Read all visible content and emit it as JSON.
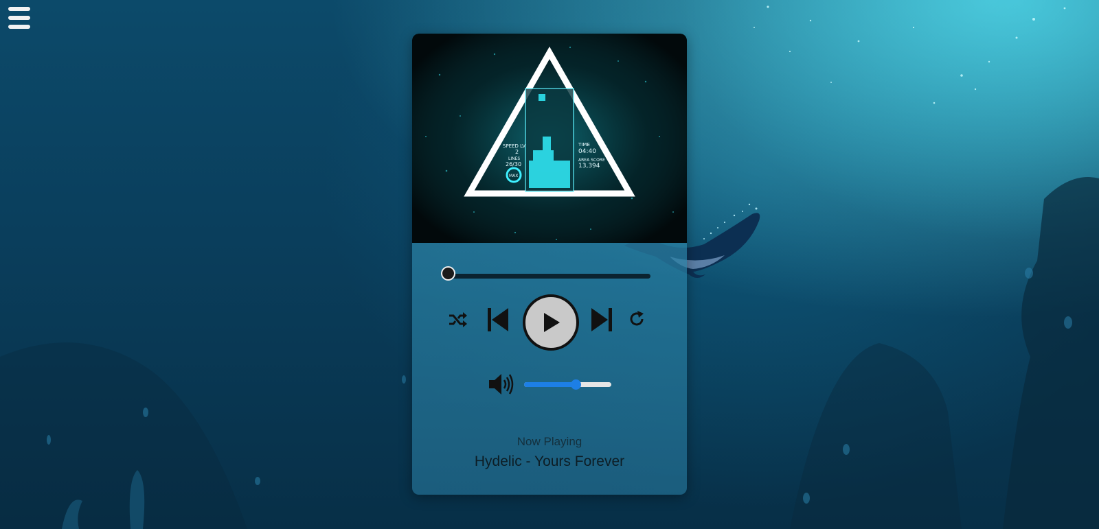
{
  "app": {
    "menu_icon": "hamburger-menu-icon"
  },
  "artwork": {
    "speed_label": "SPEED LV",
    "speed_value": "2",
    "lines_label": "LINES",
    "lines_value": "26/30",
    "max_label": "MAX",
    "time_label": "TIME",
    "time_value": "04:40",
    "score_label": "AREA SCORE",
    "score_value": "13,394"
  },
  "player": {
    "progress": 0.0,
    "controls": {
      "shuffle_icon": "shuffle-icon",
      "previous_icon": "skip-previous-icon",
      "play_icon": "play-icon",
      "next_icon": "skip-next-icon",
      "repeat_icon": "repeat-icon"
    },
    "volume": {
      "icon": "volume-icon",
      "level": 0.6
    },
    "now_playing_label": "Now Playing",
    "track_title": "Hydelic - Yours Forever"
  },
  "colors": {
    "accent": "#1d7fe6",
    "artwork_glow": "#3ff0ff"
  }
}
